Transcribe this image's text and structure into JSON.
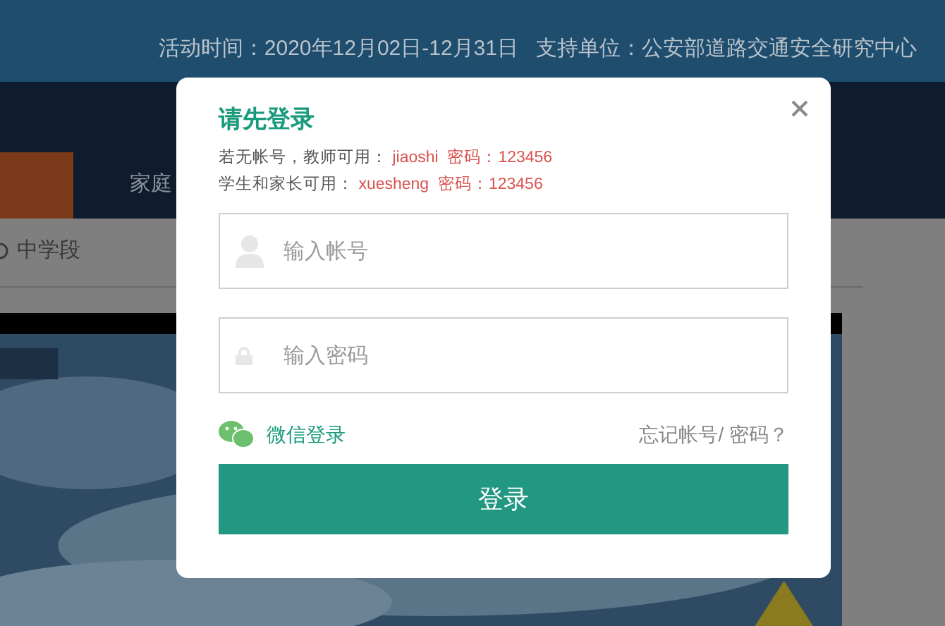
{
  "banner": {
    "info": "活动时间：2020年12月02日-12月31日   支持单位：公安部道路交通安全研究中心"
  },
  "nav": {
    "items": [
      {
        "label": "家庭",
        "selected": false
      }
    ]
  },
  "stage_tabs": [
    {
      "label": "中学段"
    }
  ],
  "login_dialog": {
    "title": "请先登录",
    "hints": [
      {
        "prefix": "若无帐号，教师可用：",
        "account": "jiaoshi",
        "password_label": "密码：",
        "password": "123456"
      },
      {
        "prefix": "学生和家长可用：",
        "account": "xuesheng",
        "password_label": "密码：",
        "password": "123456"
      }
    ],
    "account_field": {
      "placeholder": "输入帐号"
    },
    "password_field": {
      "placeholder": "输入密码"
    },
    "wechat_login": "微信登录",
    "forgot_link": "忘记帐号/ 密码？",
    "submit": "登录"
  }
}
